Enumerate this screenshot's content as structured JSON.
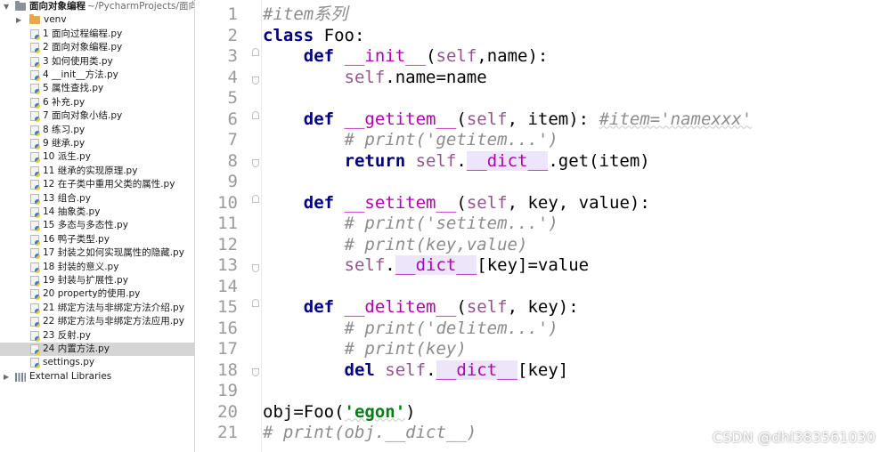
{
  "project": {
    "name": "面向对象编程",
    "path": "~/PycharmProjects/面向"
  },
  "tree": {
    "venv": "venv",
    "files": [
      "1 面向过程编程.py",
      "2 面向对象编程.py",
      "3 如何使用类.py",
      "4 __init__方法.py",
      "5 属性查找.py",
      "6 补充.py",
      "7 面向对象小结.py",
      "8 练习.py",
      "9 继承.py",
      "10 派生.py",
      "11 继承的实现原理.py",
      "12 在子类中重用父类的属性.py",
      "13 组合.py",
      "14 抽象类.py",
      "15 多态与多态性.py",
      "16 鸭子类型.py",
      "17 封装之如何实现属性的隐藏.py",
      "18 封装的意义.py",
      "19 封装与扩展性.py",
      "20 property的使用.py",
      "21 绑定方法与非绑定方法介绍.py",
      "22 绑定方法与非绑定方法应用.py",
      "23 反射.py",
      "24 内置方法.py",
      "settings.py"
    ],
    "selected_index": 23,
    "external_libraries": "External Libraries"
  },
  "editor": {
    "line_numbers": [
      "1",
      "2",
      "3",
      "4",
      "5",
      "6",
      "7",
      "8",
      "9",
      "10",
      "11",
      "12",
      "13",
      "14",
      "15",
      "16",
      "17",
      "18",
      "19",
      "20",
      "21"
    ],
    "code": {
      "l1": "#item系列",
      "l2_kw": "class",
      "l2_rest": " Foo:",
      "l3_kw": "def",
      "l3_name": "__init__",
      "l3_p1": "(",
      "l3_self": "self",
      "l3_p2": ",name):",
      "l4_self": "self",
      "l4_rest": ".name=name",
      "l6_kw": "def",
      "l6_name": "__getitem__",
      "l6_p1": "(",
      "l6_self": "self",
      "l6_p2": ", item):",
      "l6_cmt": "#item='namexxx'",
      "l7": "# print('getitem...')",
      "l8_kw": "return",
      "l8_self": "self",
      "l8_dict": "__dict__",
      "l8_rest": ".get(item)",
      "l10_kw": "def",
      "l10_name": "__setitem__",
      "l10_p1": "(",
      "l10_self": "self",
      "l10_p2": ", key, value):",
      "l11": "# print('setitem...')",
      "l12": "# print(key,value)",
      "l13_self": "self",
      "l13_dict": "__dict__",
      "l13_rest": "[key]=value",
      "l15_kw": "def",
      "l15_name": "__delitem__",
      "l15_p1": "(",
      "l15_self": "self",
      "l15_p2": ", key):",
      "l16": "# print('delitem...')",
      "l17": "# print(key)",
      "l18_kw": "del",
      "l18_self": "self",
      "l18_dict": "__dict__",
      "l18_rest": "[key]",
      "l20_a": "obj=Foo(",
      "l20_str": "'egon'",
      "l20_b": ")",
      "l21": "# print(obj.__dict__)"
    }
  },
  "watermark": "CSDN @dhl383561030"
}
